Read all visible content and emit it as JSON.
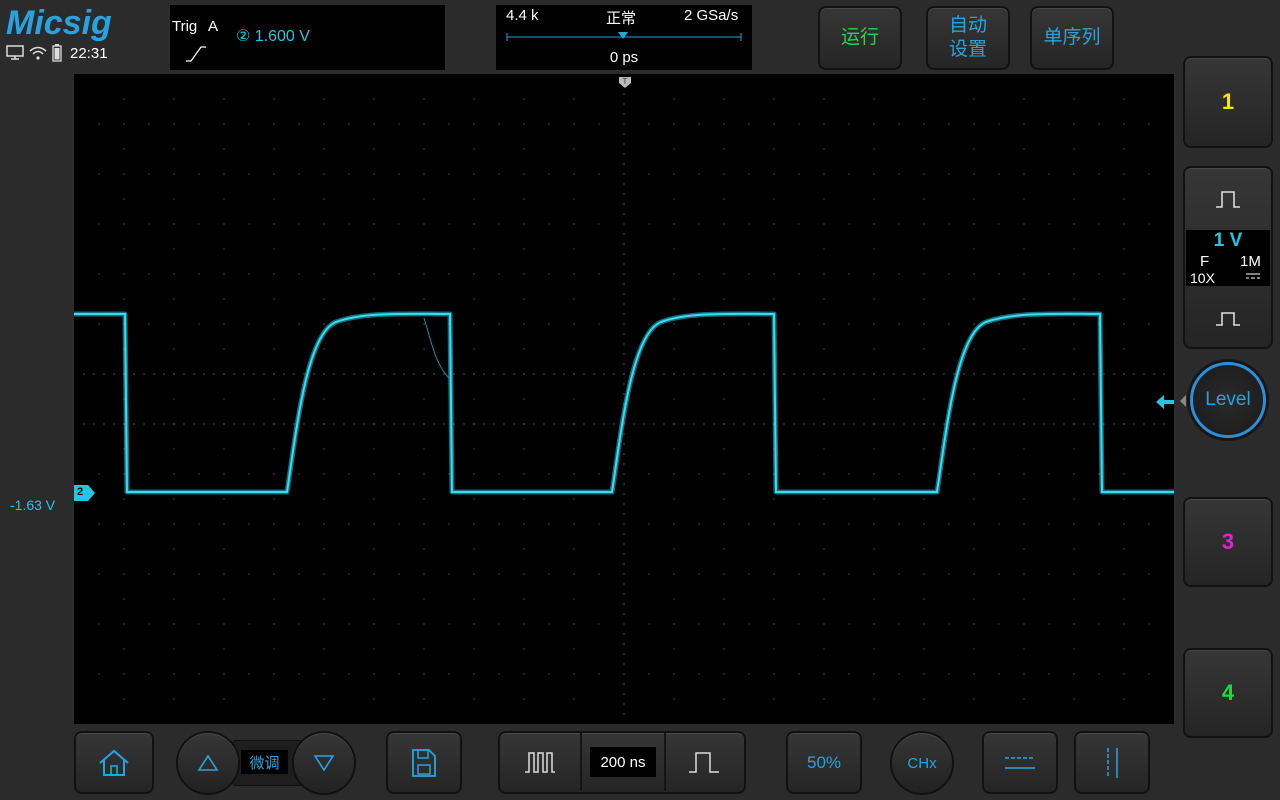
{
  "brand": "Micsig",
  "status": {
    "time": "22:31"
  },
  "trigger": {
    "label": "Trig",
    "source": "A",
    "channel_level": "② 1.600  V"
  },
  "timebase": {
    "memory": "4.4 k",
    "mode": "正常",
    "sample_rate": "2 GSa/s",
    "delay": "0 ps",
    "scale": "200 ns"
  },
  "top_buttons": {
    "run": "运行",
    "auto_line1": "自动",
    "auto_line2": "设置",
    "single": "单序列"
  },
  "channel_offset": "-1.63 V",
  "channel_marker": "2",
  "channels": {
    "ch1": {
      "label": "1",
      "color": "#f5e613"
    },
    "ch2": {
      "volts_div": "1 V",
      "bw": "F",
      "impedance": "1M",
      "probe": "10X",
      "color": "#22c6e0"
    },
    "ch3": {
      "label": "3",
      "color": "#e81ed2"
    },
    "ch4": {
      "label": "4",
      "color": "#1fdb3c"
    }
  },
  "level_button": "Level",
  "bottom": {
    "fine": "微调",
    "fifty": "50%",
    "chx": "CHx"
  },
  "colors": {
    "accent": "#29a3e0",
    "trace": "#22c6e0",
    "run": "#2bd24a"
  }
}
